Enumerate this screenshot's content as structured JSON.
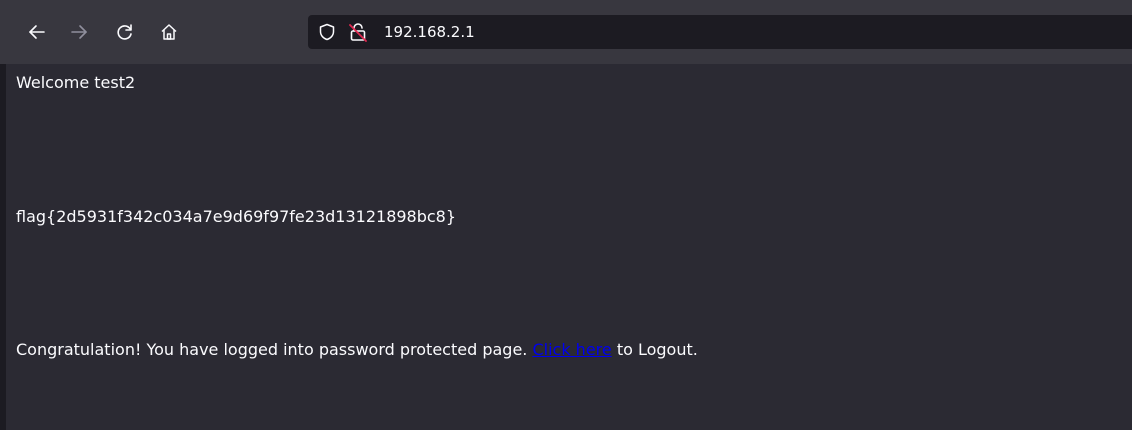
{
  "browser": {
    "url": "192.168.2.1",
    "icons": {
      "back": "back-arrow-icon",
      "forward": "forward-arrow-icon",
      "reload": "reload-icon",
      "home": "home-icon",
      "tracking": "shield-icon",
      "insecure": "insecure-lock-icon"
    }
  },
  "page": {
    "welcome": "Welcome test2",
    "flag": "flag{2d5931f342c034a7e9d69f97fe23d13121898bc8}",
    "congrats_prefix": "Congratulation! You have logged into password protected page.",
    "link_text": "Click here",
    "congrats_suffix": "to Logout."
  },
  "colors": {
    "background": "#2b2a33",
    "text": "#fbfbfe",
    "link": "#0000ee",
    "urlbar": "#1c1b22",
    "insecure_accent": "#e22850"
  }
}
